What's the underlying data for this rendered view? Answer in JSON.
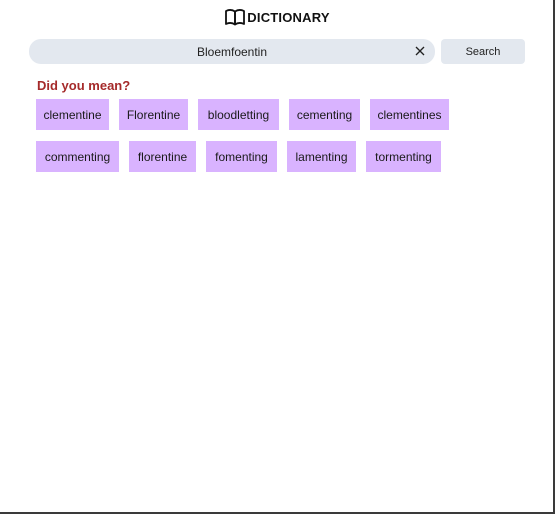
{
  "header": {
    "title": "DICTIONARY",
    "logo_icon": "open-book-icon"
  },
  "search": {
    "value": "Bloemfoentin",
    "clear_icon": "close-icon",
    "button_label": "Search"
  },
  "did_you_mean": {
    "label": "Did you mean?",
    "rows": [
      [
        "clementine",
        "Florentine",
        "bloodletting",
        "cementing",
        "clementines"
      ],
      [
        "commenting",
        "florentine",
        "fomenting",
        "lamenting",
        "tormenting"
      ]
    ]
  },
  "colors": {
    "suggestion_bg": "#d9b3ff",
    "heading": "#a52a2a",
    "search_bg": "#e3e8ef"
  }
}
